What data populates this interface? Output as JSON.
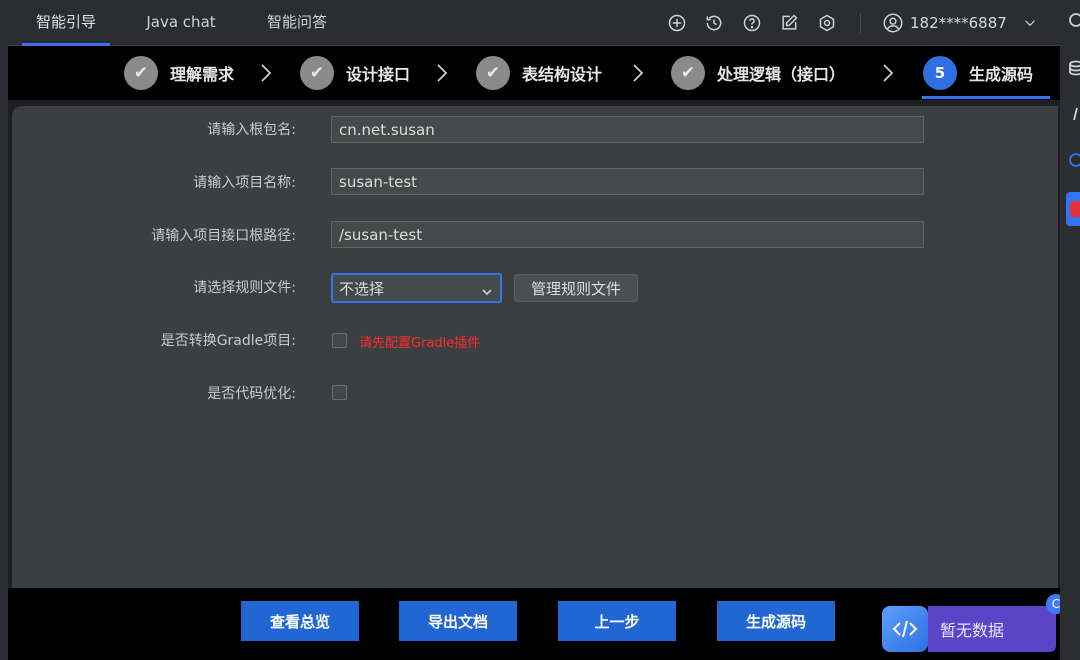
{
  "header": {
    "tabs": [
      {
        "label": "智能引导",
        "active": true
      },
      {
        "label": "Java chat",
        "active": false
      },
      {
        "label": "智能问答",
        "active": false
      }
    ],
    "icons": [
      "add-circle-icon",
      "history-icon",
      "help-icon",
      "edit-icon",
      "settings-icon"
    ],
    "user": {
      "name": "182****6887",
      "icon": "user-icon"
    }
  },
  "stepper": {
    "steps": [
      {
        "label": "理解需求",
        "marker": "✔",
        "status": "done"
      },
      {
        "label": "设计接口",
        "marker": "✔",
        "status": "done"
      },
      {
        "label": "表结构设计",
        "marker": "✔",
        "status": "done"
      },
      {
        "label": "处理逻辑（接口）",
        "marker": "✔",
        "status": "done"
      },
      {
        "label": "生成源码",
        "marker": "5",
        "status": "current"
      }
    ]
  },
  "form": {
    "root_package": {
      "label": "请输入根包名:",
      "value": "cn.net.susan"
    },
    "project_name": {
      "label": "请输入项目名称:",
      "value": "susan-test"
    },
    "api_root_path": {
      "label": "请输入项目接口根路径:",
      "value": "/susan-test"
    },
    "rule_file": {
      "label": "请选择规则文件:",
      "selected": "不选择",
      "manage_label": "管理规则文件"
    },
    "gradle": {
      "label": "是否转换Gradle项目:",
      "checked": false,
      "warning": "请先配置Gradle插件"
    },
    "optimize": {
      "label": "是否代码优化:",
      "checked": false
    }
  },
  "footer": {
    "buttons": [
      "查看总览",
      "导出文档",
      "上一步",
      "生成源码"
    ],
    "no_data": "暂无数据",
    "badge": "C"
  },
  "colors": {
    "accent": "#3574f0",
    "primary_button": "#2266d4",
    "warning": "#ff2b2b",
    "panel": "#3c3f41"
  }
}
